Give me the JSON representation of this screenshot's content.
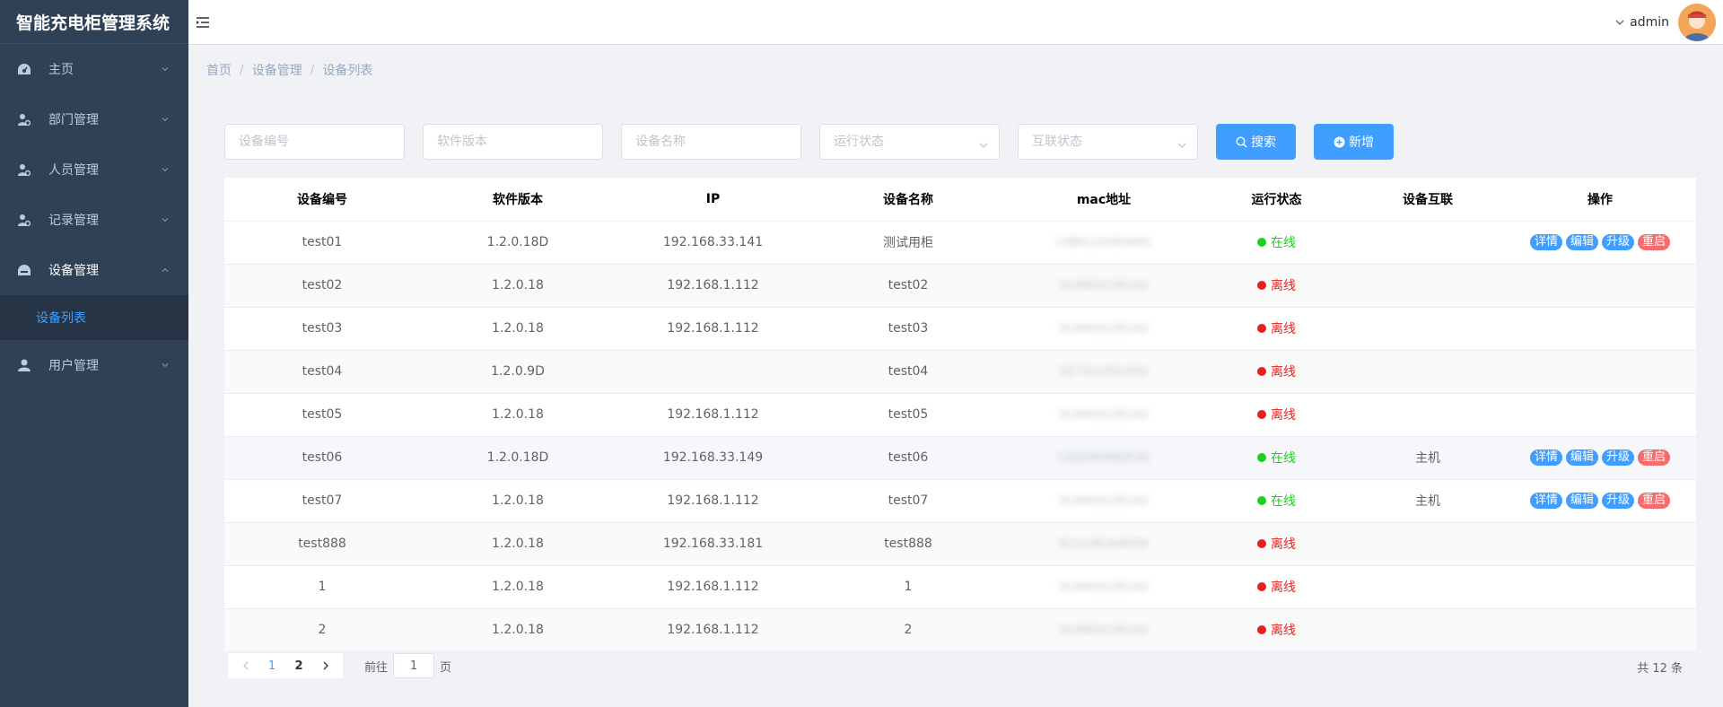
{
  "app": {
    "title": "智能充电柜管理系统"
  },
  "sidebar": {
    "items": [
      {
        "label": "主页",
        "icon": "dashboard-icon",
        "expanded": false
      },
      {
        "label": "部门管理",
        "icon": "user-gear-icon",
        "expanded": false
      },
      {
        "label": "人员管理",
        "icon": "user-gear-icon",
        "expanded": false
      },
      {
        "label": "记录管理",
        "icon": "user-gear-icon",
        "expanded": false
      },
      {
        "label": "设备管理",
        "icon": "device-icon",
        "expanded": true,
        "children": [
          {
            "label": "设备列表",
            "active": true
          }
        ]
      },
      {
        "label": "用户管理",
        "icon": "user-icon",
        "expanded": false
      }
    ]
  },
  "header": {
    "username": "admin"
  },
  "breadcrumb": [
    "首页",
    "设备管理",
    "设备列表"
  ],
  "filters": {
    "device_no_placeholder": "设备编号",
    "software_version_placeholder": "软件版本",
    "device_name_placeholder": "设备名称",
    "run_status_placeholder": "运行状态",
    "interconnect_status_placeholder": "互联状态",
    "search_label": "搜索",
    "add_label": "新增"
  },
  "table": {
    "columns": [
      "设备编号",
      "软件版本",
      "IP",
      "设备名称",
      "mac地址",
      "运行状态",
      "设备互联",
      "操作"
    ],
    "rows": [
      {
        "no": "test01",
        "ver": "1.2.0.18D",
        "ip": "192.168.33.141",
        "name": "测试用柜",
        "mac": "C0B01103E4691",
        "status": "在线",
        "online": true,
        "link": "",
        "ops": true
      },
      {
        "no": "test02",
        "ver": "1.2.0.18",
        "ip": "192.168.1.112",
        "name": "test02",
        "mac": "5C0602C3EC62",
        "status": "离线",
        "online": false,
        "link": "",
        "ops": false
      },
      {
        "no": "test03",
        "ver": "1.2.0.18",
        "ip": "192.168.1.112",
        "name": "test03",
        "mac": "5C0602C3EC62",
        "status": "离线",
        "online": false,
        "link": "",
        "ops": false
      },
      {
        "no": "test04",
        "ver": "1.2.0.9D",
        "ip": "",
        "name": "test04",
        "mac": "5E7321FD1930",
        "status": "离线",
        "online": false,
        "link": "",
        "ops": false
      },
      {
        "no": "test05",
        "ver": "1.2.0.18",
        "ip": "192.168.1.112",
        "name": "test05",
        "mac": "5C0602C3EC62",
        "status": "离线",
        "online": false,
        "link": "",
        "ops": false
      },
      {
        "no": "test06",
        "ver": "1.2.0.18D",
        "ip": "192.168.33.149",
        "name": "test06",
        "mac": "C92D4046DF30",
        "status": "在线",
        "online": true,
        "link": "主机",
        "ops": true
      },
      {
        "no": "test07",
        "ver": "1.2.0.18",
        "ip": "192.168.1.112",
        "name": "test07",
        "mac": "5C0602C3EC62",
        "status": "在线",
        "online": true,
        "link": "主机",
        "ops": true
      },
      {
        "no": "test888",
        "ver": "1.2.0.18",
        "ip": "192.168.33.181",
        "name": "test888",
        "mac": "EC1C4E3A6009",
        "status": "离线",
        "online": false,
        "link": "",
        "ops": false
      },
      {
        "no": "1",
        "ver": "1.2.0.18",
        "ip": "192.168.1.112",
        "name": "1",
        "mac": "5C0602C3EC62",
        "status": "离线",
        "online": false,
        "link": "",
        "ops": false
      },
      {
        "no": "2",
        "ver": "1.2.0.18",
        "ip": "192.168.1.112",
        "name": "2",
        "mac": "5C0602C3EC62",
        "status": "离线",
        "online": false,
        "link": "",
        "ops": false
      }
    ],
    "op_labels": {
      "detail": "详情",
      "edit": "编辑",
      "upgrade": "升级",
      "restart": "重启"
    }
  },
  "pagination": {
    "pages": [
      "1",
      "2"
    ],
    "current": "1",
    "goto_prefix": "前往",
    "goto_value": "1",
    "goto_suffix": "页",
    "total": "共 12 条"
  },
  "colors": {
    "sidebar_bg": "#304156",
    "accent": "#409eff",
    "online": "#19d319",
    "offline": "#e8201f",
    "danger": "#f56c6c"
  }
}
